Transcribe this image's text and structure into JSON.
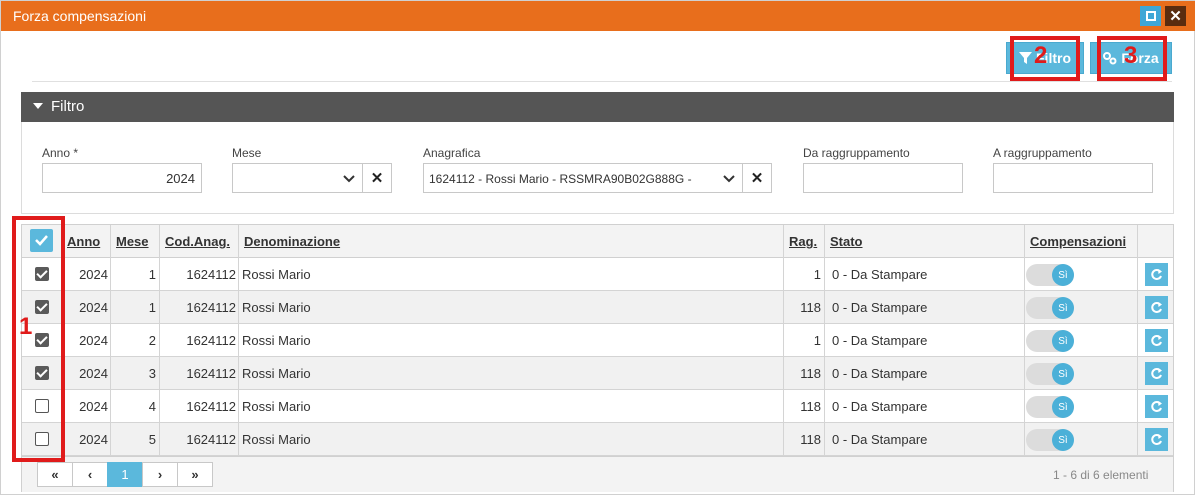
{
  "window": {
    "title": "Forza compensazioni"
  },
  "toolbar": {
    "filtro_label": "Filtro",
    "forza_label": "Forza"
  },
  "annotations": {
    "box1": "1",
    "box2": "2",
    "box3": "3"
  },
  "filter_panel": {
    "title": "Filtro",
    "anno_label": "Anno *",
    "anno_value": "2024",
    "mese_label": "Mese",
    "mese_value": "",
    "anagrafica_label": "Anagrafica",
    "anagrafica_value": "1624112 - Rossi Mario - RSSMRA90B02G888G -",
    "da_label": "Da raggruppamento",
    "da_value": "",
    "a_label": "A raggruppamento",
    "a_value": ""
  },
  "grid": {
    "headers": {
      "anno": "Anno",
      "mese": "Mese",
      "cod": "Cod.Anag.",
      "denominazione": "Denominazione",
      "rag": "Rag.",
      "stato": "Stato",
      "compensazioni": "Compensazioni"
    },
    "rows": [
      {
        "checked": true,
        "anno": "2024",
        "mese": "1",
        "cod": "1624112",
        "denominazione": "Rossi Mario",
        "rag": "1",
        "stato": "0 - Da Stampare",
        "comp": "Sì"
      },
      {
        "checked": true,
        "anno": "2024",
        "mese": "1",
        "cod": "1624112",
        "denominazione": "Rossi Mario",
        "rag": "118",
        "stato": "0 - Da Stampare",
        "comp": "Sì"
      },
      {
        "checked": true,
        "anno": "2024",
        "mese": "2",
        "cod": "1624112",
        "denominazione": "Rossi Mario",
        "rag": "1",
        "stato": "0 - Da Stampare",
        "comp": "Sì"
      },
      {
        "checked": true,
        "anno": "2024",
        "mese": "3",
        "cod": "1624112",
        "denominazione": "Rossi Mario",
        "rag": "118",
        "stato": "0 - Da Stampare",
        "comp": "Sì"
      },
      {
        "checked": false,
        "anno": "2024",
        "mese": "4",
        "cod": "1624112",
        "denominazione": "Rossi Mario",
        "rag": "118",
        "stato": "0 - Da Stampare",
        "comp": "Sì"
      },
      {
        "checked": false,
        "anno": "2024",
        "mese": "5",
        "cod": "1624112",
        "denominazione": "Rossi Mario",
        "rag": "118",
        "stato": "0 - Da Stampare",
        "comp": "Sì"
      }
    ]
  },
  "pager": {
    "first": "«",
    "prev": "‹",
    "current": "1",
    "next": "›",
    "last": "»",
    "info": "1 - 6 di 6 elementi"
  },
  "colors": {
    "titlebar": "#e86e1c",
    "accent": "#5bb8dc",
    "annotation": "#e01b1b",
    "panel_header": "#555555"
  }
}
